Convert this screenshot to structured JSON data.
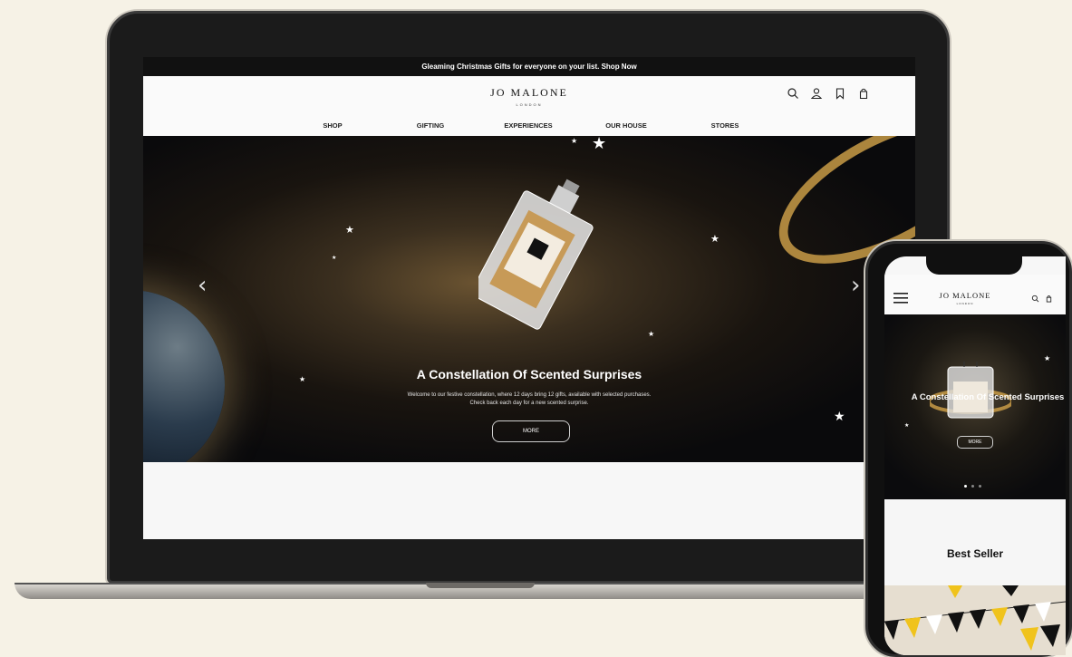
{
  "desktop": {
    "promo_text": "Gleaming Christmas Gifts for everyone on your list. Shop Now",
    "logo": {
      "main": "JO MALONE",
      "sub": "LONDON"
    },
    "header_icons": [
      "search-icon",
      "account-icon",
      "wishlist-icon",
      "bag-icon"
    ],
    "nav": [
      "SHOP",
      "GIFTING",
      "EXPERIENCES",
      "OUR HOUSE",
      "STORES"
    ],
    "hero": {
      "title": "A Constellation Of Scented Surprises",
      "description_line1": "Welcome to our festive constellation, where 12 days bring 12 gifts, available with selected purchases.",
      "description_line2": "Check back each day for a new scented surprise.",
      "cta": "MORE",
      "prev_arrow": "‹",
      "next_arrow": "›"
    }
  },
  "mobile": {
    "logo": {
      "main": "JO MALONE",
      "sub": "LONDON"
    },
    "header_icons": [
      "menu-icon",
      "search-icon",
      "bag-icon"
    ],
    "hero": {
      "title": "A Constellation Of Scented Surprises",
      "cta": "MORE",
      "slides": 3,
      "active_slide": 1
    },
    "section_title": "Best Seller"
  },
  "colors": {
    "background": "#f6f2e6",
    "gold": "#c89b46",
    "hero_dark": "#0a0a0c"
  }
}
